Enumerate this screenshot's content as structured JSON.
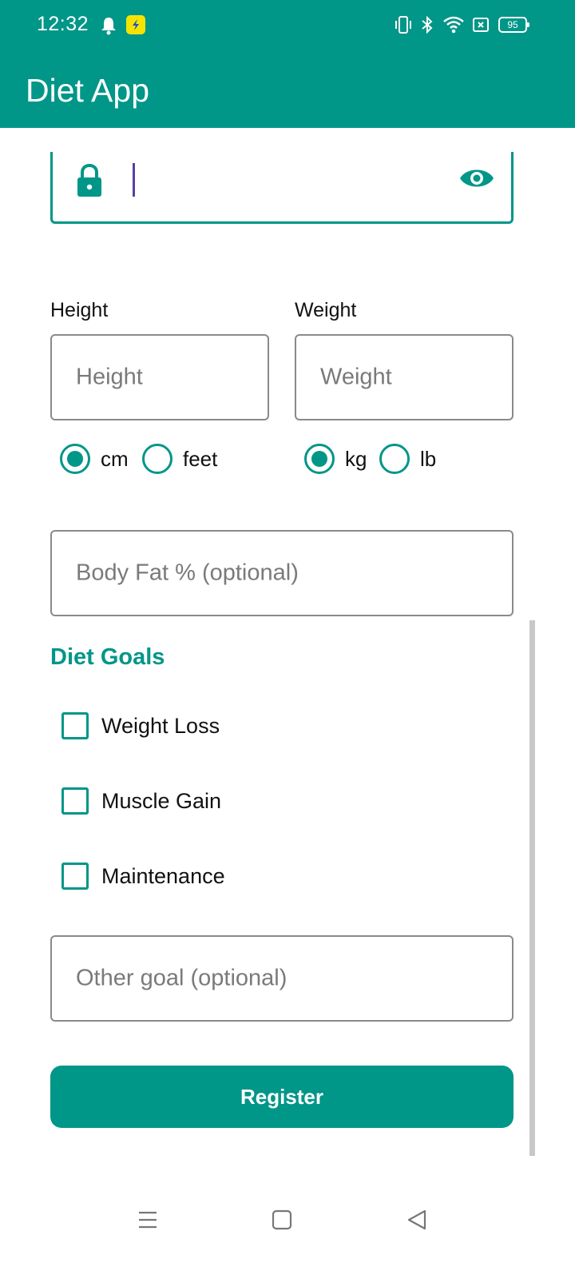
{
  "status_bar": {
    "time": "12:32",
    "battery": "95",
    "icons": [
      "bell-icon",
      "app-notification-icon",
      "vibrate-icon",
      "bluetooth-icon",
      "wifi-icon",
      "no-sim-icon",
      "battery-icon"
    ]
  },
  "app_bar": {
    "title": "Diet App"
  },
  "password": {
    "value": "",
    "icons": [
      "lock-icon",
      "eye-icon"
    ]
  },
  "height": {
    "label": "Height",
    "placeholder": "Height",
    "units": [
      {
        "label": "cm",
        "selected": true
      },
      {
        "label": "feet",
        "selected": false
      }
    ]
  },
  "weight": {
    "label": "Weight",
    "placeholder": "Weight",
    "units": [
      {
        "label": "kg",
        "selected": true
      },
      {
        "label": "lb",
        "selected": false
      }
    ]
  },
  "body_fat": {
    "placeholder": "Body Fat % (optional)"
  },
  "diet_goals": {
    "title": "Diet Goals",
    "options": [
      {
        "label": "Weight Loss",
        "checked": false
      },
      {
        "label": "Muscle Gain",
        "checked": false
      },
      {
        "label": "Maintenance",
        "checked": false
      }
    ]
  },
  "other_goal": {
    "placeholder": "Other goal (optional)"
  },
  "register_label": "Register",
  "colors": {
    "primary": "#009688",
    "caret": "#5a3fa0",
    "outline": "#8a8a8a"
  },
  "nav_bar": {
    "icons": [
      "menu-icon",
      "home-icon",
      "back-icon"
    ]
  }
}
